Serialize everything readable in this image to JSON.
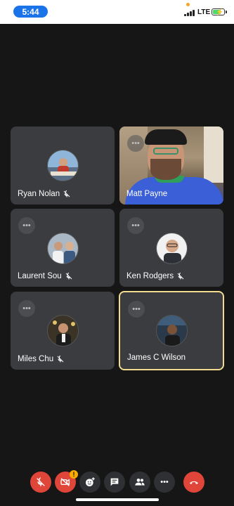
{
  "status_bar": {
    "time": "5:44",
    "network": "LTE"
  },
  "participants": [
    {
      "name": "Ryan Nolan",
      "muted": true,
      "video": false
    },
    {
      "name": "Matt Payne",
      "muted": false,
      "video": true
    },
    {
      "name": "Laurent Sou",
      "muted": true,
      "video": false
    },
    {
      "name": "Ken Rodgers",
      "muted": true,
      "video": false
    },
    {
      "name": "Miles Chu",
      "muted": true,
      "video": false
    },
    {
      "name": "James C Wilson",
      "muted": false,
      "video": false,
      "active_speaker": true
    }
  ],
  "more_label": "•••",
  "controls": {
    "mic_icon": "mic-off-icon",
    "camera_icon": "camera-off-icon",
    "camera_warning": "!",
    "reactions_icon": "emoji-reaction-icon",
    "chat_icon": "chat-icon",
    "people_icon": "people-icon",
    "more_icon": "more-horizontal-icon",
    "more_label": "•••",
    "leave_icon": "hang-up-icon"
  },
  "colors": {
    "accent": "#1a73e8",
    "danger": "#e0453a",
    "active_border": "#f1dc8f",
    "tile": "#3b3c3f",
    "background": "#161616"
  }
}
